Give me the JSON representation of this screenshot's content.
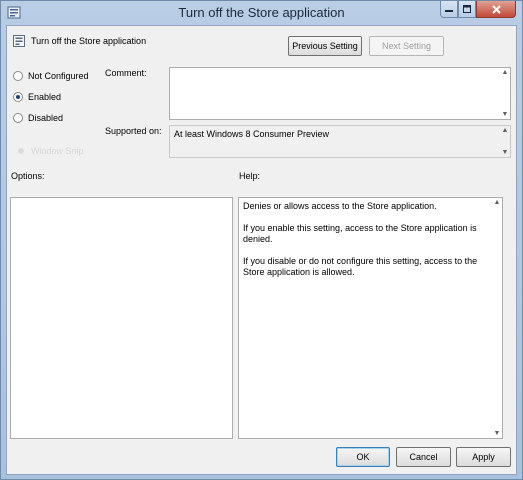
{
  "window": {
    "title": "Turn off the Store application"
  },
  "setting": {
    "name": "Turn off the Store application"
  },
  "nav": {
    "previous_label": "Previous Setting",
    "next_label": "Next Setting"
  },
  "state": {
    "options": [
      {
        "label": "Not Configured",
        "checked": false
      },
      {
        "label": "Enabled",
        "checked": true
      },
      {
        "label": "Disabled",
        "checked": false
      }
    ]
  },
  "comment": {
    "label": "Comment:",
    "value": ""
  },
  "supported": {
    "label": "Supported on:",
    "value": "At least Windows 8 Consumer Preview"
  },
  "faded_overlay": {
    "text": "Window Snip"
  },
  "options_panel": {
    "label": "Options:"
  },
  "help_panel": {
    "label": "Help:",
    "paragraphs": [
      "Denies or allows access to the Store application.",
      "If you enable this setting, access to the Store application is denied.",
      "If you disable or do not configure this setting, access to the Store application is allowed."
    ]
  },
  "footer": {
    "ok_label": "OK",
    "cancel_label": "Cancel",
    "apply_label": "Apply"
  },
  "icons": {
    "app": "policy-icon",
    "setting": "policy-setting-icon",
    "minimize": "minimize-icon",
    "maximize": "maximize-icon",
    "close": "close-icon"
  }
}
